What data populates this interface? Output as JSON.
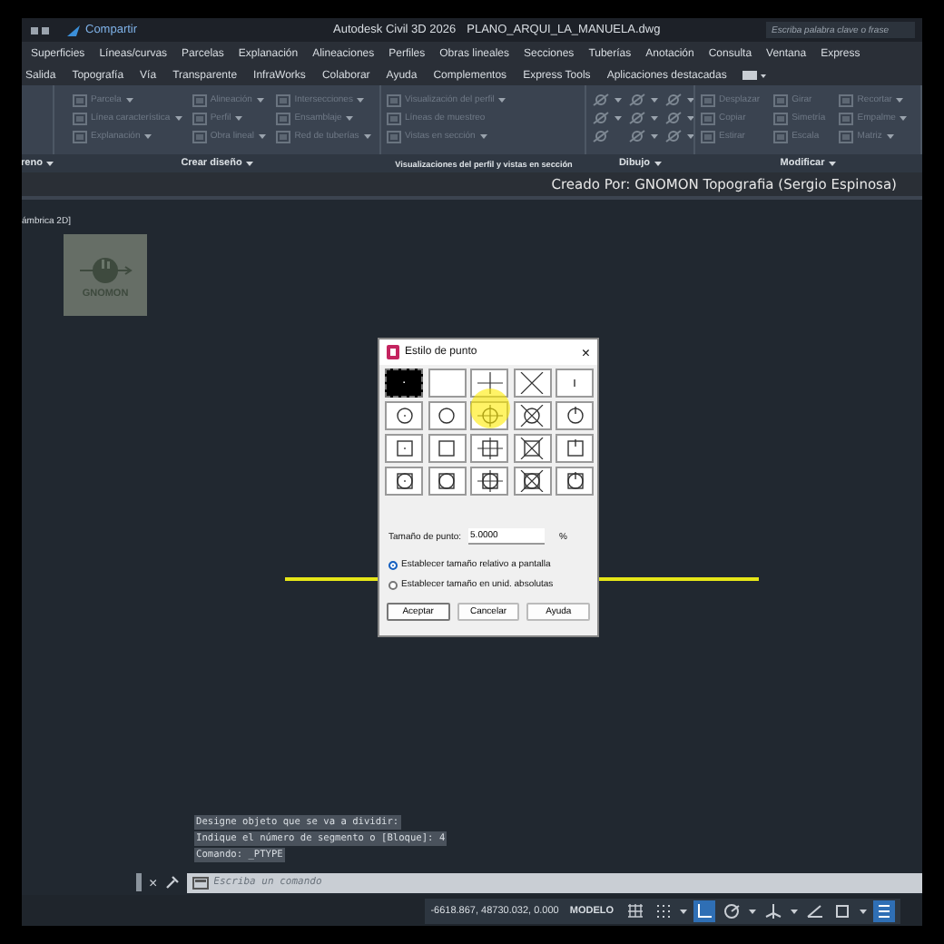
{
  "title_bar": {
    "share": "Compartir",
    "title": "Autodesk Civil 3D 2026",
    "file": "PLANO_ARQUI_LA_MANUELA.dwg",
    "search": {
      "placeholder": "Escriba palabra clave o frase"
    }
  },
  "menu_rows": [
    [
      "Superficies",
      "Líneas/curvas",
      "Parcelas",
      "Explanación",
      "Alineaciones",
      "Perfiles",
      "Obras lineales",
      "Secciones",
      "Tuberías",
      "Anotación",
      "Consulta",
      "Ventana",
      "Express"
    ],
    [
      "Salida",
      "Topografía",
      "Vía",
      "Transparente",
      "InfraWorks",
      "Colaborar",
      "Ayuda",
      "Complementos",
      "Express Tools",
      "Aplicaciones destacadas"
    ]
  ],
  "ribbon": [
    {
      "title": "reno"
    },
    {
      "title": "Crear diseño",
      "items": [
        {
          "label": "Parcela",
          "dropdown": true
        },
        {
          "label": "Línea característica",
          "dropdown": true
        },
        {
          "label": "Explanación",
          "dropdown": true
        },
        {
          "label": "Alineación",
          "dropdown": true
        },
        {
          "label": "Perfil",
          "dropdown": true
        },
        {
          "label": "Obra lineal",
          "dropdown": true
        },
        {
          "label": "Intersecciones",
          "dropdown": true
        },
        {
          "label": "Ensamblaje",
          "dropdown": true
        },
        {
          "label": "Red de tuberías",
          "dropdown": true
        }
      ]
    },
    {
      "title": "Visualizaciones del perfil y vistas en sección",
      "items": [
        {
          "label": "Visualización del perfil",
          "dropdown": true
        },
        {
          "label": "Líneas de muestreo",
          "dropdown": false
        },
        {
          "label": "Vistas en sección",
          "dropdown": true
        }
      ]
    },
    {
      "title": "Dibujo",
      "items": [
        {
          "dropdown": true
        },
        {
          "dropdown": true
        },
        {
          "dropdown": false
        },
        {
          "dropdown": true
        },
        {
          "dropdown": true
        },
        {
          "dropdown": true
        },
        {
          "dropdown": true
        },
        {
          "dropdown": true
        },
        {
          "dropdown": true
        }
      ]
    },
    {
      "title": "Modificar",
      "items": [
        {
          "label": "Desplazar",
          "dropdown": false
        },
        {
          "label": "Copiar",
          "dropdown": false
        },
        {
          "label": "Estirar",
          "dropdown": false
        },
        {
          "label": "Girar",
          "dropdown": false
        },
        {
          "label": "Simetría",
          "dropdown": false
        },
        {
          "label": "Escala",
          "dropdown": false
        },
        {
          "label": "Recortar",
          "dropdown": true
        },
        {
          "label": "Empalme",
          "dropdown": true
        },
        {
          "label": "Matriz",
          "dropdown": true
        }
      ]
    }
  ],
  "credit": "Creado Por: GNOMON Topografia (Sergio Espinosa)",
  "viewport": {
    "label": "ámbrica 2D]",
    "logo": "GNOMON"
  },
  "dialog": {
    "title": "Estilo de punto",
    "close": "×",
    "styles": [
      {
        "kind": "dot",
        "selected": true
      },
      {
        "kind": "none",
        "selected": false
      },
      {
        "kind": "plus",
        "selected": false
      },
      {
        "kind": "cross",
        "selected": false
      },
      {
        "kind": "tick",
        "selected": false
      },
      {
        "kind": "dot-circle",
        "selected": false
      },
      {
        "kind": "none-circle",
        "selected": false
      },
      {
        "kind": "plus-circle",
        "selected": false
      },
      {
        "kind": "cross-circle",
        "selected": false
      },
      {
        "kind": "tick-circle",
        "selected": false
      },
      {
        "kind": "dot-square",
        "selected": false
      },
      {
        "kind": "none-square",
        "selected": false
      },
      {
        "kind": "plus-square",
        "selected": false
      },
      {
        "kind": "cross-square",
        "selected": false
      },
      {
        "kind": "tick-square",
        "selected": false
      },
      {
        "kind": "dot-both",
        "selected": false
      },
      {
        "kind": "none-both",
        "selected": false
      },
      {
        "kind": "plus-both",
        "selected": false
      },
      {
        "kind": "cross-both",
        "selected": false
      },
      {
        "kind": "tick-both",
        "selected": false
      }
    ],
    "size_label": "Tamaño de punto:",
    "size_value": "5.0000",
    "size_unit": "%",
    "options": [
      {
        "label": "Establecer tamaño relativo a pantalla",
        "selected": true
      },
      {
        "label": "Establecer tamaño en unid. absolutas",
        "selected": false
      }
    ],
    "buttons": [
      "Aceptar",
      "Cancelar",
      "Ayuda"
    ]
  },
  "command_history": [
    "Designe objeto que se va a dividir:",
    "Indique el número de segmento o [Bloque]: 4",
    "Comando: _PTYPE"
  ],
  "command_line": {
    "close": "×",
    "placeholder": "Escriba un comando"
  },
  "status_bar": {
    "coordinates": "-6618.867, 48730.032, 0.000",
    "space": "MODELO",
    "tools": [
      {
        "kind": "grid",
        "on": false
      },
      {
        "kind": "snap",
        "on": false
      },
      {
        "kind": "caret"
      },
      {
        "kind": "ortho",
        "on": true
      },
      {
        "kind": "polar",
        "on": false
      },
      {
        "kind": "caret"
      },
      {
        "kind": "iso",
        "on": false
      },
      {
        "kind": "caret"
      },
      {
        "kind": "angle",
        "on": false
      },
      {
        "kind": "osnap",
        "on": false
      },
      {
        "kind": "caret"
      },
      {
        "kind": "menu",
        "on": true
      }
    ]
  }
}
